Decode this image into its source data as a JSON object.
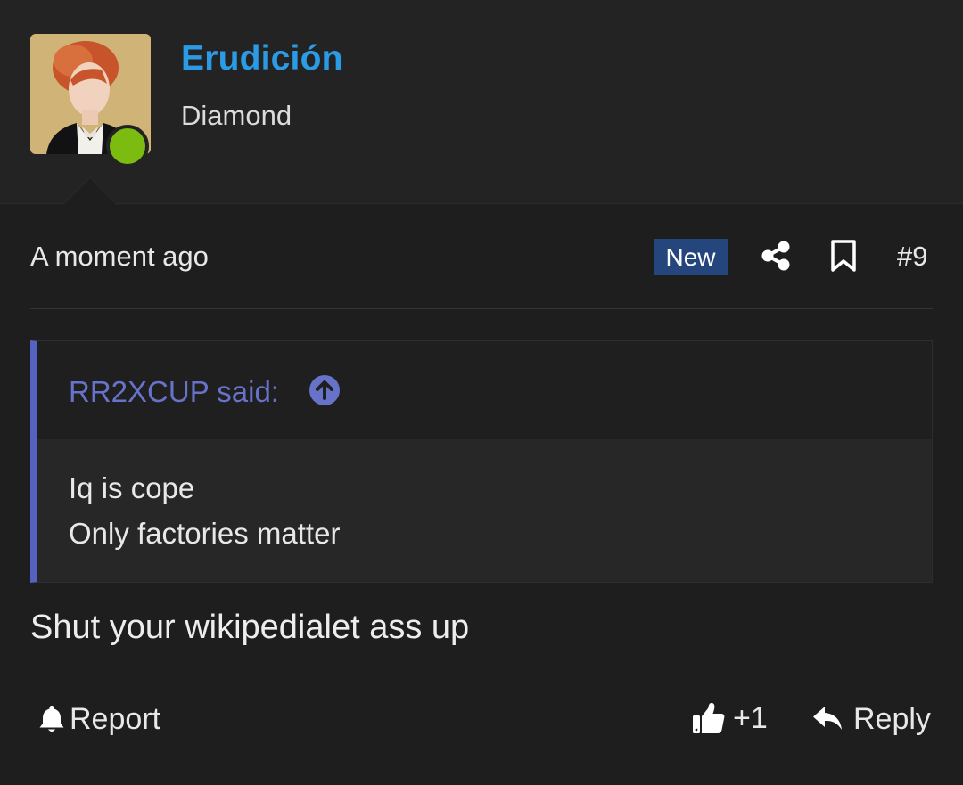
{
  "user": {
    "name": "Erudición",
    "title": "Diamond",
    "online_color": "#7cbb10",
    "avatar": "avatar-portrait"
  },
  "post": {
    "time": "A moment ago",
    "badge": "New",
    "number": "#9",
    "icons": [
      "share-icon",
      "bookmark-icon"
    ]
  },
  "quote": {
    "author_label": "RR2XCUP said:",
    "lines": [
      "Iq is cope",
      "Only factories matter"
    ],
    "icon": "arrow-up-circle-icon"
  },
  "body": "Shut your wikipedialet ass up",
  "actions": {
    "report": "Report",
    "reaction_count": "+1",
    "reply": "Reply"
  },
  "colors": {
    "username": "#2c9be6",
    "quote_accent": "#5562c2",
    "badge": "#25467d",
    "background": "#1e1e1f"
  }
}
